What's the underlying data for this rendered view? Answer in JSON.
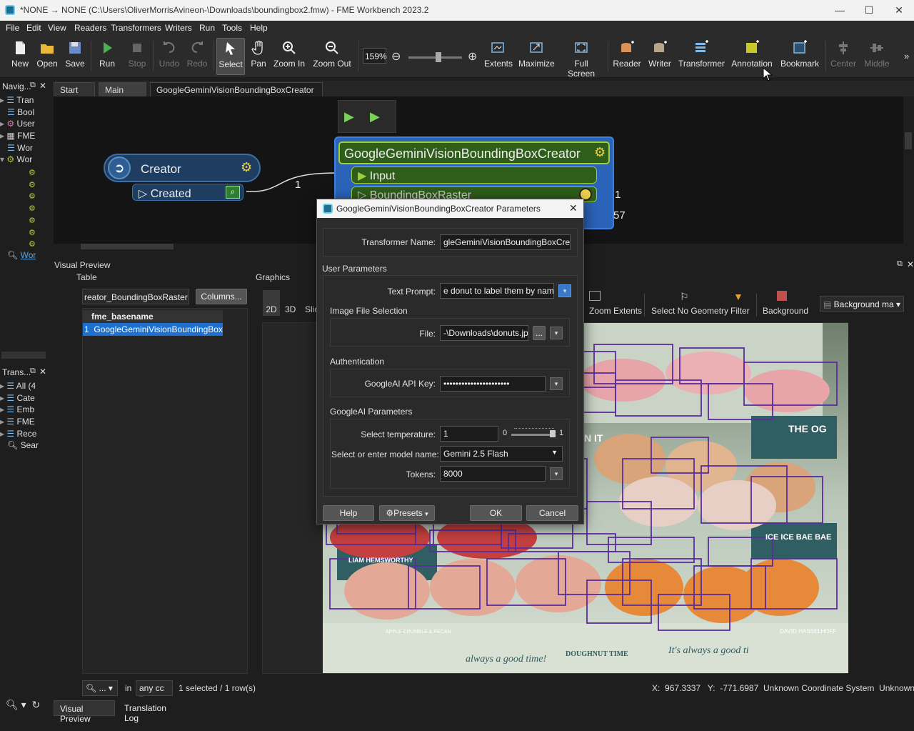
{
  "window": {
    "title": "*NONE → NONE (C:\\Users\\OliverMorrisAvineon-\\Downloads\\boundingbox2.fmw) - FME Workbench 2023.2"
  },
  "menu": [
    "File",
    "Edit",
    "View",
    "Readers",
    "Transformers",
    "Writers",
    "Run",
    "Tools",
    "Help"
  ],
  "toolbar": {
    "new": "New",
    "open": "Open",
    "save": "Save",
    "run": "Run",
    "stop": "Stop",
    "undo": "Undo",
    "redo": "Redo",
    "select": "Select",
    "pan": "Pan",
    "zoom_in": "Zoom In",
    "zoom_out": "Zoom Out",
    "zoom_level": "159%",
    "extents": "Extents",
    "maximize": "Maximize",
    "full_screen": "Full Screen",
    "reader": "Reader",
    "writer": "Writer",
    "transformer": "Transformer",
    "annotation": "Annotation",
    "bookmark": "Bookmark",
    "center": "Center",
    "middle": "Middle",
    "more": "»"
  },
  "navigator": {
    "title": "Navig...",
    "items": [
      "Tran",
      "Bool",
      "User",
      "FME",
      "Wor",
      "Wor",
      "Wor"
    ]
  },
  "transformer_gallery": {
    "title": "Trans...",
    "items": [
      "All (4",
      "Cate",
      "Emb",
      "FME",
      "Rece",
      "Sear"
    ]
  },
  "tabs": [
    "Start",
    "Main",
    "GoogleGeminiVisionBoundingBoxCreator"
  ],
  "canvas": {
    "creator_title": "Creator",
    "creator_port": "Created",
    "creator_count": "1",
    "gemini_title": "GoogleGeminiVisionBoundingBoxCreator",
    "gemini_input": "Input",
    "gemini_output": "BoundingBoxRaster",
    "out_count_1": "1",
    "out_count_2": "57"
  },
  "preview": {
    "title": "Visual Preview",
    "table_label": "Table",
    "graphics_label": "Graphics",
    "table_selector": "reator_BoundingBoxRaster",
    "columns_btn": "Columns...",
    "col_header": "fme_basename",
    "row_index": "1",
    "row_value": "GoogleGeminiVisionBoundingBox...",
    "view_2d": "2D",
    "view_3d": "3D",
    "view_slice": "Slic",
    "zoom_extents": "Zoom Extents",
    "select_no_geom": "Select No Geometry",
    "filter": "Filter",
    "background": "Background",
    "background_map": "Background ma",
    "search_in": "in",
    "search_scope": "any cc",
    "search_dd": "...",
    "selection_status": "1 selected / 1 row(s)",
    "photo_signs": [
      "THE OG",
      "ICE ICE BAE BAE",
      "LIAM HEMSWORTHY",
      "N IT",
      "DOUGHNUT TIME",
      "It's always a good ti",
      "always a good time!",
      "DAVID HASSELHOFF",
      "APPLE CRUMBLE & PECAN"
    ]
  },
  "status": {
    "x_label": "X:",
    "x_value": "967.3337",
    "y_label": "Y:",
    "y_value": "-771.6987",
    "coord_sys": "Unknown Coordinate System",
    "units": "Unknown Units"
  },
  "bottom_tabs": [
    "Visual Preview",
    "Translation Log"
  ],
  "dialog": {
    "title": "GoogleGeminiVisionBoundingBoxCreator Parameters",
    "transformer_name_label": "Transformer Name:",
    "transformer_name": "gleGeminiVisionBoundingBoxCreator",
    "user_params": "User Parameters",
    "text_prompt_label": "Text Prompt:",
    "text_prompt": "e donut to label them by name.",
    "image_section": "Image File Selection",
    "file_label": "File:",
    "file_value": "-\\Downloads\\donuts.jpg",
    "browse": "...",
    "auth_section": "Authentication",
    "api_key_label": "GoogleAI API Key:",
    "api_key": "••••••••••••••••••••••",
    "ai_section": "GoogleAI Parameters",
    "temp_label": "Select temperature:",
    "temp_value": "1",
    "temp_min": "0",
    "temp_max": "1",
    "temp_fraction": 1.0,
    "model_label": "Select or enter model name:",
    "model_value": "Gemini 2.5 Flash",
    "tokens_label": "Tokens:",
    "tokens_value": "8000",
    "help": "Help",
    "presets": "Presets",
    "ok": "OK",
    "cancel": "Cancel"
  },
  "colors": {
    "accent": "#1d6fd0",
    "node_blue": "#23476e",
    "node_green": "#2f5d1a",
    "bbox": "#5a2d9c"
  }
}
